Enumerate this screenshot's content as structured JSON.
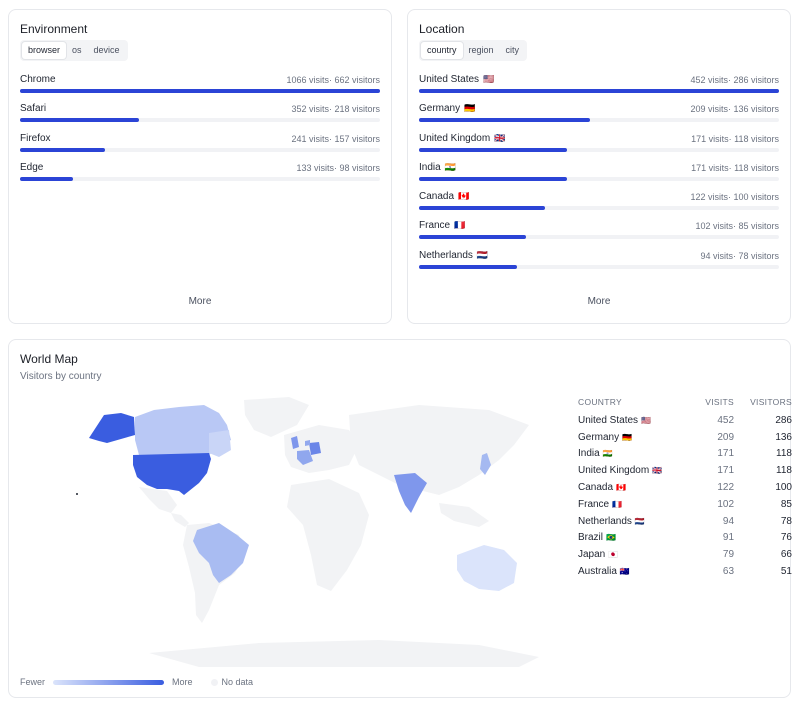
{
  "environment": {
    "title": "Environment",
    "tabs": [
      {
        "label": "browser",
        "active": true
      },
      {
        "label": "os",
        "active": false
      },
      {
        "label": "device",
        "active": false
      }
    ],
    "rows": [
      {
        "label": "Chrome",
        "stat": "1066 visits· 662 visitors",
        "fraction": 1.0
      },
      {
        "label": "Safari",
        "stat": "352 visits· 218 visitors",
        "fraction": 0.33
      },
      {
        "label": "Firefox",
        "stat": "241 visits· 157 visitors",
        "fraction": 0.236
      },
      {
        "label": "Edge",
        "stat": "133 visits· 98 visitors",
        "fraction": 0.147
      }
    ],
    "more_label": "More"
  },
  "location": {
    "title": "Location",
    "tabs": [
      {
        "label": "country",
        "active": true
      },
      {
        "label": "region",
        "active": false
      },
      {
        "label": "city",
        "active": false
      }
    ],
    "rows": [
      {
        "label": "United States",
        "flag": "🇺🇸",
        "stat": "452 visits· 286 visitors",
        "fraction": 1.0
      },
      {
        "label": "Germany",
        "flag": "🇩🇪",
        "stat": "209 visits· 136 visitors",
        "fraction": 0.475
      },
      {
        "label": "United Kingdom",
        "flag": "🇬🇧",
        "stat": "171 visits· 118 visitors",
        "fraction": 0.41
      },
      {
        "label": "India",
        "flag": "🇮🇳",
        "stat": "171 visits· 118 visitors",
        "fraction": 0.41
      },
      {
        "label": "Canada",
        "flag": "🇨🇦",
        "stat": "122 visits· 100 visitors",
        "fraction": 0.35
      },
      {
        "label": "France",
        "flag": "🇫🇷",
        "stat": "102 visits· 85 visitors",
        "fraction": 0.297
      },
      {
        "label": "Netherlands",
        "flag": "🇳🇱",
        "stat": "94 visits· 78 visitors",
        "fraction": 0.272
      }
    ],
    "more_label": "More"
  },
  "world_map": {
    "title": "World Map",
    "subtitle": "Visitors by country",
    "table_headers": [
      "COUNTRY",
      "VISITS",
      "VISITORS"
    ],
    "table_rows": [
      {
        "country": "United States",
        "flag": "🇺🇸",
        "visits": "452",
        "visitors": "286"
      },
      {
        "country": "Germany",
        "flag": "🇩🇪",
        "visits": "209",
        "visitors": "136"
      },
      {
        "country": "India",
        "flag": "🇮🇳",
        "visits": "171",
        "visitors": "118"
      },
      {
        "country": "United Kingdom",
        "flag": "🇬🇧",
        "visits": "171",
        "visitors": "118"
      },
      {
        "country": "Canada",
        "flag": "🇨🇦",
        "visits": "122",
        "visitors": "100"
      },
      {
        "country": "France",
        "flag": "🇫🇷",
        "visits": "102",
        "visitors": "85"
      },
      {
        "country": "Netherlands",
        "flag": "🇳🇱",
        "visits": "94",
        "visitors": "78"
      },
      {
        "country": "Brazil",
        "flag": "🇧🇷",
        "visits": "91",
        "visitors": "76"
      },
      {
        "country": "Japan",
        "flag": "🇯🇵",
        "visits": "79",
        "visitors": "66"
      },
      {
        "country": "Australia",
        "flag": "🇦🇺",
        "visits": "63",
        "visitors": "51"
      }
    ],
    "legend": {
      "fewer": "Fewer",
      "more": "More",
      "no_data": "No data"
    },
    "colors": {
      "nodata": "#f2f3f5",
      "low": "#dbe4fb",
      "high": "#3a5de0",
      "bar": "#2b44d6"
    }
  }
}
